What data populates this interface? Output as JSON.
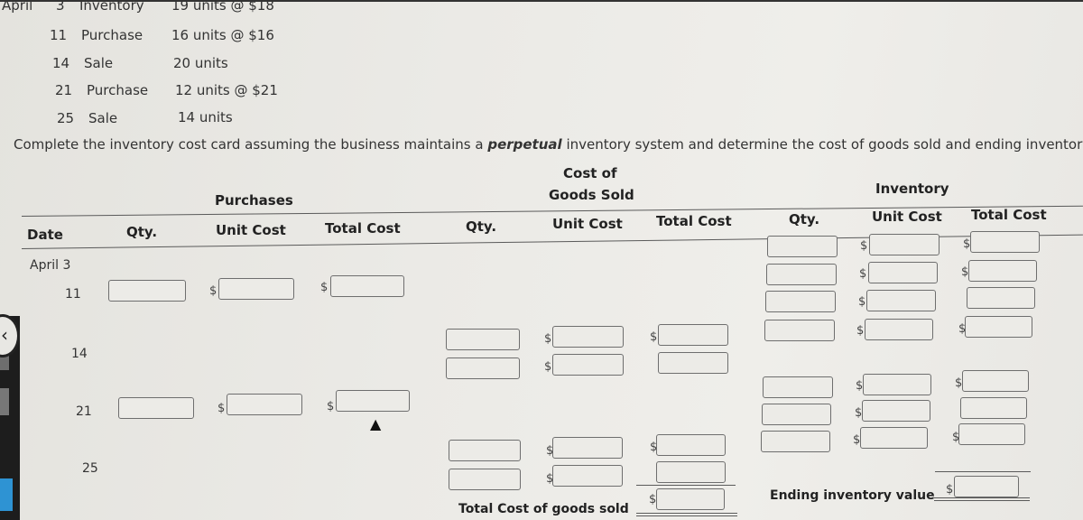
{
  "given": [
    {
      "month": "April",
      "day": "3",
      "type": "Inventory",
      "detail": "19 units @  $18"
    },
    {
      "month": "",
      "day": "11",
      "type": "Purchase",
      "detail": "16 units @  $16"
    },
    {
      "month": "",
      "day": "14",
      "type": "Sale",
      "detail": "20 units"
    },
    {
      "month": "",
      "day": "21",
      "type": "Purchase",
      "detail": "12 units @  $21"
    },
    {
      "month": "",
      "day": "25",
      "type": "Sale",
      "detail": "14 units"
    }
  ],
  "instructions": {
    "pre": "Complete the inventory cost card assuming the business maintains a ",
    "emph": "perpetual",
    "post": " inventory system and determine the cost of goods sold and ending inventory using LIFO"
  },
  "table": {
    "group_headers": {
      "purchases": "Purchases",
      "cogs_line1": "Cost of",
      "cogs_line2": "Goods Sold",
      "inventory": "Inventory"
    },
    "columns": {
      "date": "Date",
      "qty": "Qty.",
      "unit_cost": "Unit Cost",
      "total_cost": "Total Cost"
    },
    "dates": [
      "April  3",
      "11",
      "14",
      "21",
      "25"
    ],
    "currency_symbol": "$",
    "total_cogs_label": "Total Cost of goods sold",
    "ending_inventory_label": "Ending inventory value"
  },
  "inputs": {
    "value": "",
    "placeholder": ""
  }
}
